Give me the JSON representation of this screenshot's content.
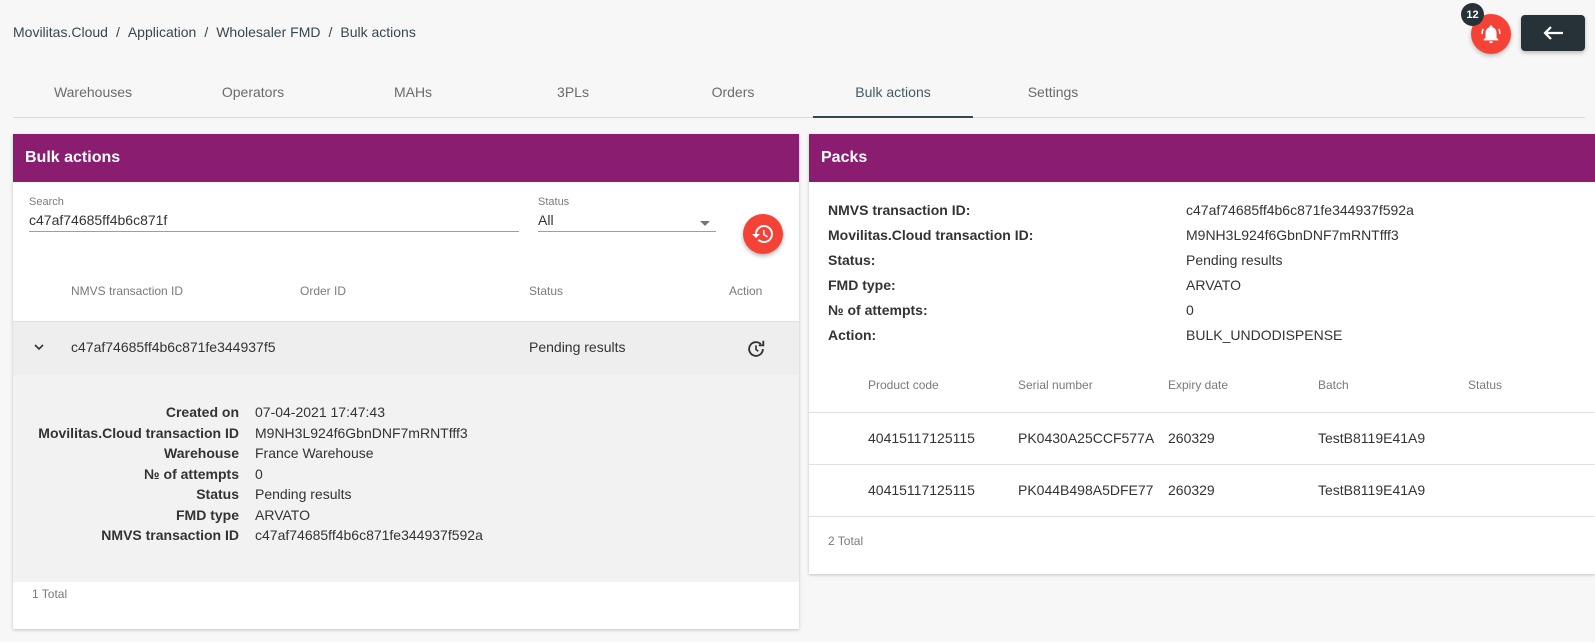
{
  "breadcrumb": [
    "Movilitas.Cloud",
    "Application",
    "Wholesaler FMD",
    "Bulk actions"
  ],
  "notifications": {
    "count": "12",
    "icon": "bell-icon"
  },
  "back_icon": "arrow-left-icon",
  "tabs": [
    {
      "label": "Warehouses",
      "active": false
    },
    {
      "label": "Operators",
      "active": false
    },
    {
      "label": "MAHs",
      "active": false
    },
    {
      "label": "3PLs",
      "active": false
    },
    {
      "label": "Orders",
      "active": false
    },
    {
      "label": "Bulk actions",
      "active": true
    },
    {
      "label": "Settings",
      "active": false
    }
  ],
  "bulk": {
    "title": "Bulk actions",
    "search": {
      "label": "Search",
      "value": "c47af74685ff4b6c871f"
    },
    "status": {
      "label": "Status",
      "value": "All"
    },
    "columns": [
      "NMVS transaction ID",
      "Order ID",
      "Status",
      "Action"
    ],
    "rows": [
      {
        "nmvs_id": "c47af74685ff4b6c871fe344937f5",
        "order_id": "",
        "status": "Pending results"
      }
    ],
    "details": [
      {
        "key": "Created on",
        "value": "07-04-2021 17:47:43"
      },
      {
        "key": "Movilitas.Cloud transaction ID",
        "value": "M9NH3L924f6GbnDNF7mRNTfff3"
      },
      {
        "key": "Warehouse",
        "value": "France Warehouse"
      },
      {
        "key": "№ of attempts",
        "value": "0"
      },
      {
        "key": "Status",
        "value": "Pending results"
      },
      {
        "key": "FMD type",
        "value": "ARVATO"
      },
      {
        "key": "NMVS transaction ID",
        "value": "c47af74685ff4b6c871fe344937f592a"
      }
    ],
    "total": "1 Total"
  },
  "packs": {
    "title": "Packs",
    "info": [
      {
        "key": "NMVS transaction ID:",
        "value": "c47af74685ff4b6c871fe344937f592a"
      },
      {
        "key": "Movilitas.Cloud transaction ID:",
        "value": "M9NH3L924f6GbnDNF7mRNTfff3"
      },
      {
        "key": "Status:",
        "value": "Pending results"
      },
      {
        "key": "FMD type:",
        "value": "ARVATO"
      },
      {
        "key": "№ of attempts:",
        "value": "0"
      },
      {
        "key": "Action:",
        "value": "BULK_UNDODISPENSE"
      }
    ],
    "columns": [
      "Product code",
      "Serial number",
      "Expiry date",
      "Batch",
      "Status"
    ],
    "rows": [
      {
        "product": "40415117125115",
        "serial": "PK0430A25CCF577A",
        "expiry": "260329",
        "batch": "TestB8119E41A9",
        "status": ""
      },
      {
        "product": "40415117125115",
        "serial": "PK044B498A5DFE77",
        "expiry": "260329",
        "batch": "TestB8119E41A9",
        "status": ""
      }
    ],
    "total": "2 Total"
  },
  "colors": {
    "header": "#8a1d70",
    "accent": "#f44336",
    "dark": "#263238"
  }
}
